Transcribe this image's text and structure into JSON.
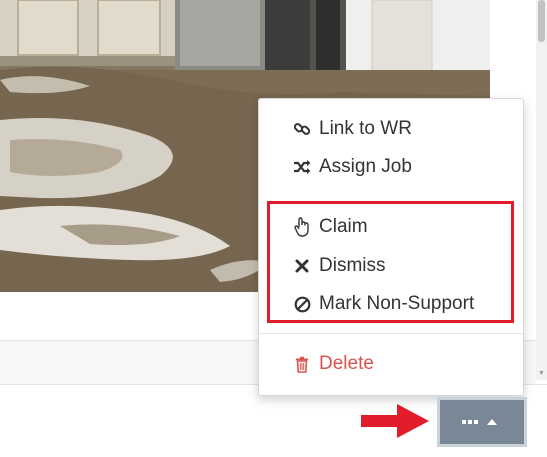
{
  "menu": {
    "items": [
      {
        "label": "Link to WR",
        "icon": "link-icon"
      },
      {
        "label": "Assign Job",
        "icon": "shuffle-icon"
      },
      {
        "label": "Claim",
        "icon": "hand-pointer-icon"
      },
      {
        "label": "Dismiss",
        "icon": "times-icon"
      },
      {
        "label": "Mark Non-Support",
        "icon": "ban-icon"
      }
    ],
    "delete": {
      "label": "Delete",
      "icon": "trash-icon"
    }
  },
  "toggle": {
    "icon": "ellipsis-icon",
    "caret": "caret-up-icon"
  },
  "colors": {
    "highlight": "#e31c2b",
    "danger": "#d9534f",
    "toggle_bg": "#7a8796",
    "annotation_arrow": "#e31c2b"
  }
}
